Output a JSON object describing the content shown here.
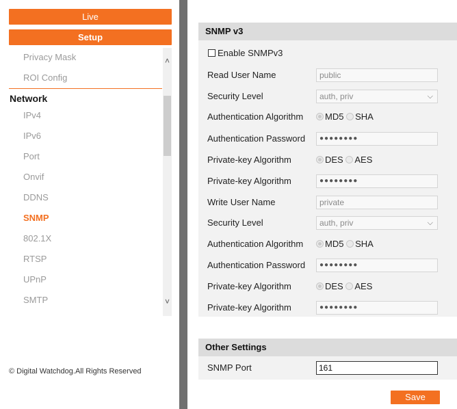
{
  "nav": {
    "live_label": "Live",
    "setup_label": "Setup"
  },
  "menu": {
    "items_top": [
      "Privacy Mask",
      "ROI Config"
    ],
    "section": "Network",
    "items": [
      "IPv4",
      "IPv6",
      "Port",
      "Onvif",
      "DDNS",
      "SNMP",
      "802.1X",
      "RTSP",
      "UPnP",
      "SMTP"
    ],
    "active": "SNMP"
  },
  "footer": {
    "copyright": "© Digital Watchdog.All Rights Reserved"
  },
  "snmp": {
    "title": "SNMP v3",
    "enable_label": "Enable SNMPv3",
    "enable_checked": false,
    "read_user_label": "Read User Name",
    "read_user_value": "public",
    "security_level_label": "Security Level",
    "read_security_value": "auth, priv",
    "auth_algo_label": "Authentication Algorithm",
    "auth_opt1": "MD5",
    "auth_opt2": "SHA",
    "auth_pwd_label": "Authentication Password",
    "pwd_mask": "●●●●●●●●",
    "priv_algo_label": "Private-key Algorithm",
    "priv_opt1": "DES",
    "priv_opt2": "AES",
    "write_user_label": "Write User Name",
    "write_user_value": "private",
    "write_security_value": "auth, priv"
  },
  "other": {
    "title": "Other Settings",
    "port_label": "SNMP Port",
    "port_value": "161"
  },
  "actions": {
    "save_label": "Save"
  },
  "colors": {
    "accent": "#f37021",
    "divider": "#707070"
  }
}
